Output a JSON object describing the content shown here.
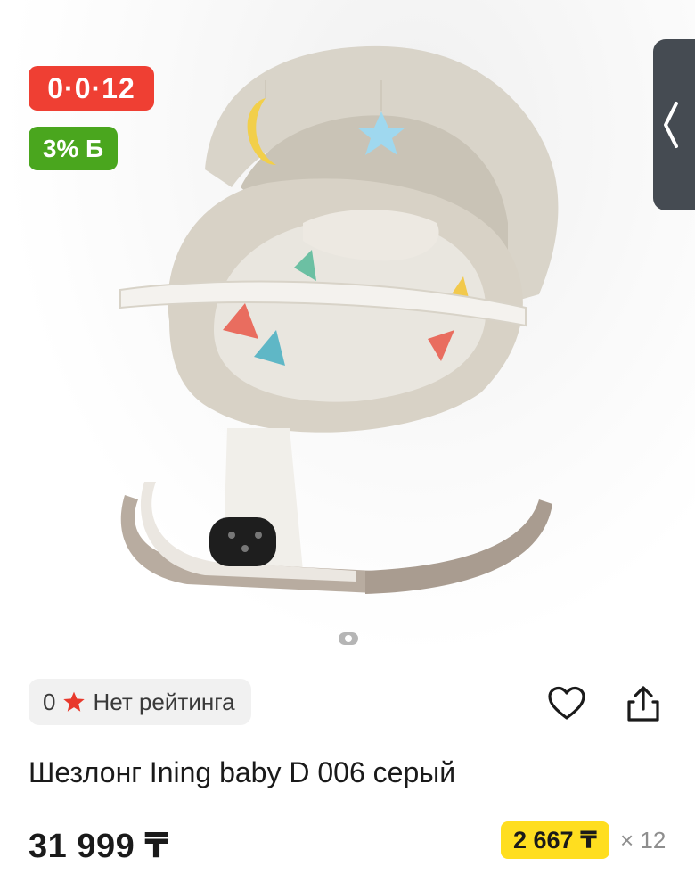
{
  "gallery": {
    "badges": {
      "installment": "0·0·12",
      "bonus": "3% Б"
    },
    "current_slide": 1
  },
  "rating": {
    "value": "0",
    "label": "Нет рейтинга"
  },
  "product": {
    "title": "Шезлонг Ining baby D 006 серый",
    "price": "31 999 ₸",
    "monthly_payment": "2 667 ₸",
    "months": "× 12"
  },
  "colors": {
    "installment_badge": "#ef3f33",
    "bonus_badge": "#4aa61e",
    "monthly_highlight": "#ffde1f",
    "rating_star": "#e8392c"
  },
  "icons": [
    "chevron-left-icon",
    "star-icon",
    "heart-icon",
    "share-icon"
  ]
}
